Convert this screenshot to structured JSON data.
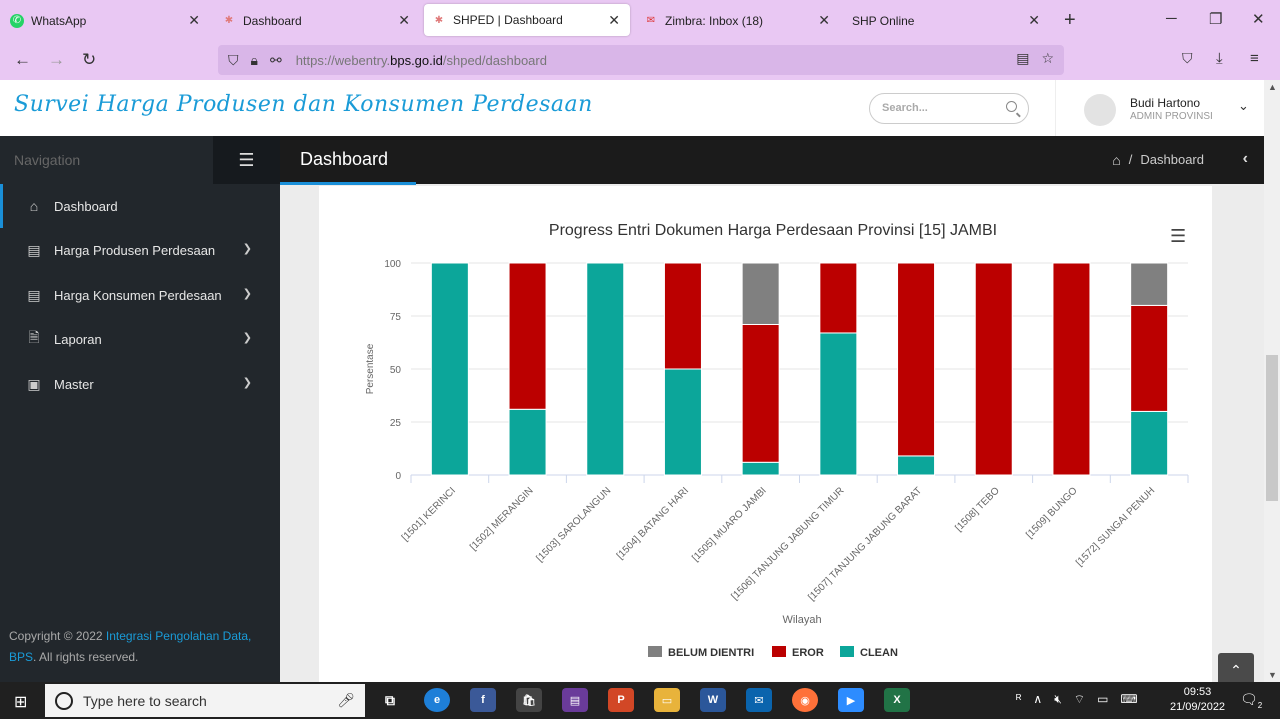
{
  "browser": {
    "tabs": [
      {
        "label": "WhatsApp",
        "icon": "whatsapp-icon",
        "color": "#25d366"
      },
      {
        "label": "Dashboard",
        "icon": "pinwheel-icon",
        "color": "#e88"
      },
      {
        "label": "SHPED | Dashboard",
        "icon": "pinwheel-icon",
        "color": "#e88",
        "active": true
      },
      {
        "label": "Zimbra: Inbox (18)",
        "icon": "zimbra-icon",
        "color": "#d33"
      },
      {
        "label": "SHP Online",
        "icon": "",
        "color": ""
      }
    ],
    "url_prefix": "https://webentry.",
    "url_domain": "bps.go.id",
    "url_path": "/shped/dashboard"
  },
  "header": {
    "title": "Survei Harga Produsen dan Konsumen Perdesaan",
    "search_placeholder": "Search...",
    "user_name": "Budi Hartono",
    "user_role": "ADMIN PROVINSI"
  },
  "sidebar": {
    "nav_label": "Navigation",
    "items": [
      {
        "label": "Dashboard",
        "icon": "home-icon",
        "active": true,
        "has_children": false
      },
      {
        "label": "Harga Produsen Perdesaan",
        "icon": "list-icon",
        "has_children": true
      },
      {
        "label": "Harga Konsumen Perdesaan",
        "icon": "list-icon",
        "has_children": true
      },
      {
        "label": "Laporan",
        "icon": "document-icon",
        "has_children": true
      },
      {
        "label": "Master",
        "icon": "card-icon",
        "has_children": true
      }
    ],
    "footer_prefix": "Copyright © 2022 ",
    "footer_link": "Integrasi Pengolahan Data, BPS",
    "footer_suffix": ". All rights reserved."
  },
  "page": {
    "title": "Dashboard",
    "breadcrumb": "Dashboard",
    "breadcrumb_sep": "/"
  },
  "chart_data": {
    "type": "bar",
    "stacked": true,
    "title": "Progress Entri Dokumen Harga Perdesaan Provinsi [15] JAMBI",
    "xlabel": "Wilayah",
    "ylabel": "Persentase",
    "ylim": [
      0,
      100
    ],
    "yticks": [
      0,
      25,
      50,
      75,
      100
    ],
    "legend_position": "bottom",
    "categories": [
      "[1501] KERINCI",
      "[1502] MERANGIN",
      "[1503] SAROLANGUN",
      "[1504] BATANG HARI",
      "[1505] MUARO JAMBI",
      "[1506] TANJUNG JABUNG TIMUR",
      "[1507] TANJUNG JABUNG BARAT",
      "[1508] TEBO",
      "[1509] BUNGO",
      "[1572] SUNGAI PENUH"
    ],
    "series": [
      {
        "name": "CLEAN",
        "color": "#0ca69a",
        "values": [
          100,
          31,
          100,
          50,
          6,
          67,
          9,
          0,
          0,
          30
        ]
      },
      {
        "name": "EROR",
        "color": "#bb0000",
        "values": [
          0,
          69,
          0,
          50,
          65,
          33,
          91,
          100,
          100,
          50
        ]
      },
      {
        "name": "BELUM DIENTRI",
        "color": "#808080",
        "values": [
          0,
          0,
          0,
          0,
          29,
          0,
          0,
          0,
          0,
          20
        ]
      }
    ],
    "legend_order": [
      "BELUM DIENTRI",
      "EROR",
      "CLEAN"
    ]
  },
  "taskbar": {
    "search_placeholder": "Type here to search",
    "time": "09:53",
    "date": "21/09/2022",
    "notif_count": "2"
  }
}
